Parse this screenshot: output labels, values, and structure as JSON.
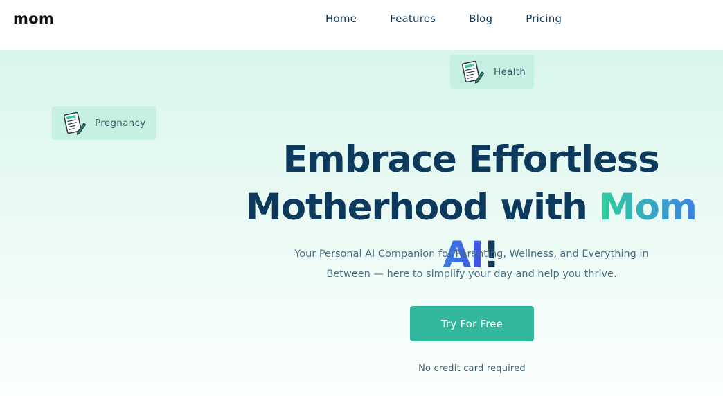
{
  "header": {
    "logo": "mom",
    "nav": [
      {
        "label": "Home"
      },
      {
        "label": "Features"
      },
      {
        "label": "Blog"
      },
      {
        "label": "Pricing"
      }
    ]
  },
  "hero": {
    "chips": {
      "health": {
        "label": "Health",
        "icon": "document-pen-icon"
      },
      "pregnancy": {
        "label": "Pregnancy",
        "icon": "document-pen-icon"
      }
    },
    "headline": {
      "line1": "Embrace Effortless",
      "line2_prefix": "Motherhood with ",
      "brand": "Mom AI",
      "suffix": "!"
    },
    "subtitle": "Your Personal AI Companion for Parenting, Wellness, and Everything in Between — here to simplify your day and help you thrive.",
    "cta_label": "Try For Free",
    "note": "No credit card required"
  },
  "colors": {
    "primary_text": "#0d3a5c",
    "cta": "#33b79c",
    "chip_bg": "#c6f0e2",
    "brand_gradient_start": "#2fcf9c",
    "brand_gradient_end": "#3f4fe6"
  }
}
